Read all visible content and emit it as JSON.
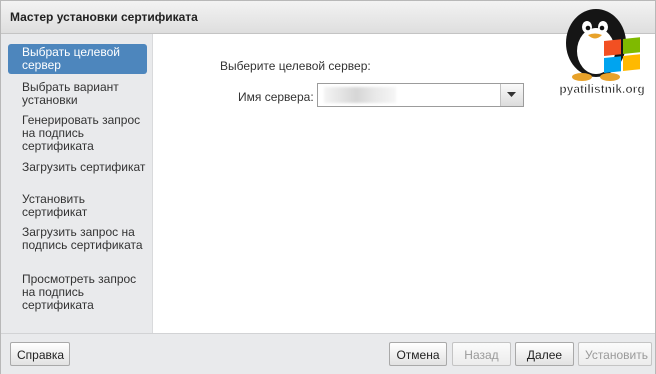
{
  "window": {
    "title": "Мастер установки сертификата"
  },
  "sidebar": {
    "steps": [
      {
        "label": "Выбрать целевой сервер",
        "active": true
      },
      {
        "label": "Выбрать вариант установки"
      },
      {
        "label": "Генерировать запрос на подпись сертификата"
      },
      {
        "label": "Загрузить сертификат"
      },
      {
        "label": "Установить сертификат"
      },
      {
        "label": "Загрузить запрос на подпись сертификата"
      },
      {
        "label": "Просмотреть запрос на подпись сертификата"
      }
    ]
  },
  "main": {
    "prompt": "Выберите целевой сервер:",
    "server_label": "Имя сервера:",
    "server_value": ""
  },
  "watermark": {
    "text": "pyatilistnik.org"
  },
  "footer": {
    "help": "Справка",
    "cancel": "Отмена",
    "back": "Назад",
    "next": "Далее",
    "install": "Установить"
  },
  "colors": {
    "accent": "#4d86bd",
    "panel": "#e9eaec"
  }
}
